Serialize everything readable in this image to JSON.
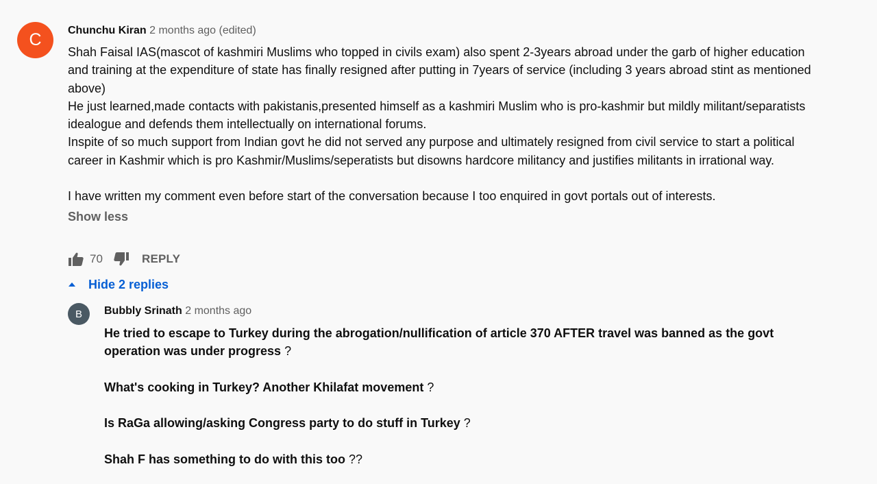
{
  "comment": {
    "avatar_letter": "C",
    "avatar_color": "#f4511e",
    "author": "Chunchu Kiran",
    "time": "2 months ago (edited)",
    "paragraphs": [
      "Shah Faisal IAS(mascot of kashmiri Muslims who topped in civils exam) also spent 2-3years abroad under the garb of higher education and training at the expenditure of state has finally resigned after putting in 7years of service (including 3 years abroad stint as mentioned above)",
      "He just learned,made contacts with pakistanis,presented himself as a kashmiri Muslim who is pro-kashmir but mildly militant/separatists idealogue and defends them intellectually on international forums.",
      "Inspite of so much support from Indian govt he did not served any purpose and ultimately resigned from civil service to start a political career in Kashmir which is pro Kashmir/Muslims/seperatists but disowns hardcore militancy and justifies militants in irrational way.",
      "I have written my comment even before start of the conversation because I too enquired in govt portals out of interests."
    ],
    "show_less": "Show less",
    "like_count": "70",
    "like_icon": "thumbs-up-icon",
    "dislike_icon": "thumbs-down-icon",
    "reply_label": "REPLY",
    "hide_replies_label": "Hide 2 replies"
  },
  "reply": {
    "avatar_letter": "B",
    "avatar_color": "#4a5963",
    "author": "Bubbly Srinath",
    "time": "2 months ago",
    "lines": [
      {
        "bold": "He tried to escape to Turkey during the abrogation/nullification of article 370 AFTER travel was banned as the govt operation was under progress",
        "rest": " ?"
      },
      {
        "bold": "What's cooking in Turkey? Another Khilafat movement",
        "rest": " ?"
      },
      {
        "bold": "Is RaGa allowing/asking Congress party to do stuff in Turkey",
        "rest": " ?"
      },
      {
        "bold": "Shah F has something to do with this too",
        "rest": " ??"
      }
    ]
  },
  "colors": {
    "background": "#f9f9f9",
    "text": "#0f0f0f",
    "secondary_text": "#606060",
    "link_blue": "#065fd4"
  }
}
